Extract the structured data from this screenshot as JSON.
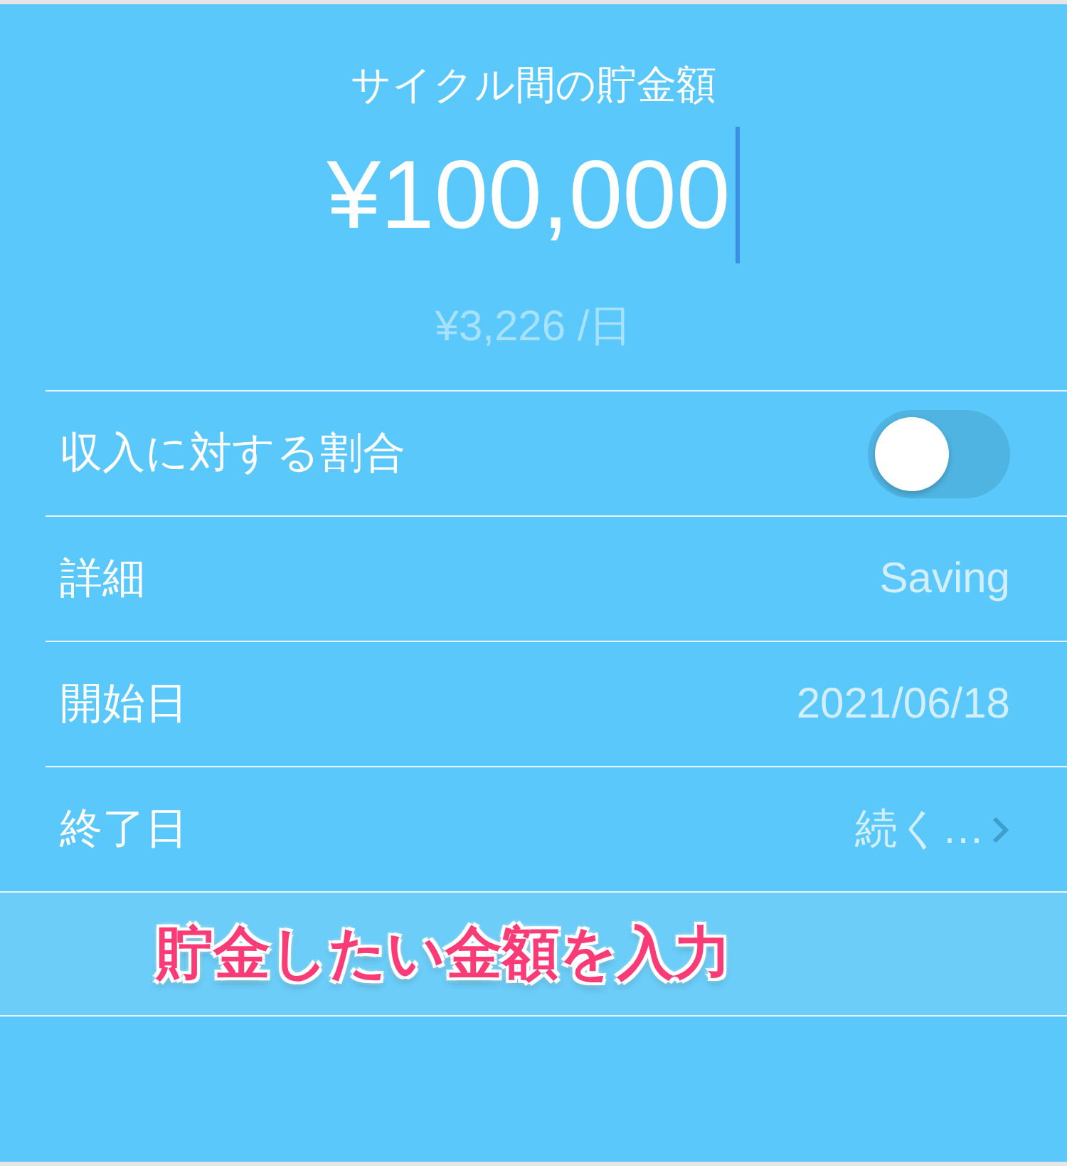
{
  "header": {
    "title": "サイクル間の貯金額",
    "amount": "¥100,000",
    "per_day": "¥3,226 /日"
  },
  "rows": [
    {
      "kind": "toggle",
      "label": "収入に対する割合",
      "on": false
    },
    {
      "kind": "value",
      "label": "詳細",
      "value": "Saving"
    },
    {
      "kind": "value",
      "label": "開始日",
      "value": "2021/06/18"
    },
    {
      "kind": "link",
      "label": "終了日",
      "value": "続く…"
    }
  ],
  "annotation": "貯金したい金額を入力"
}
